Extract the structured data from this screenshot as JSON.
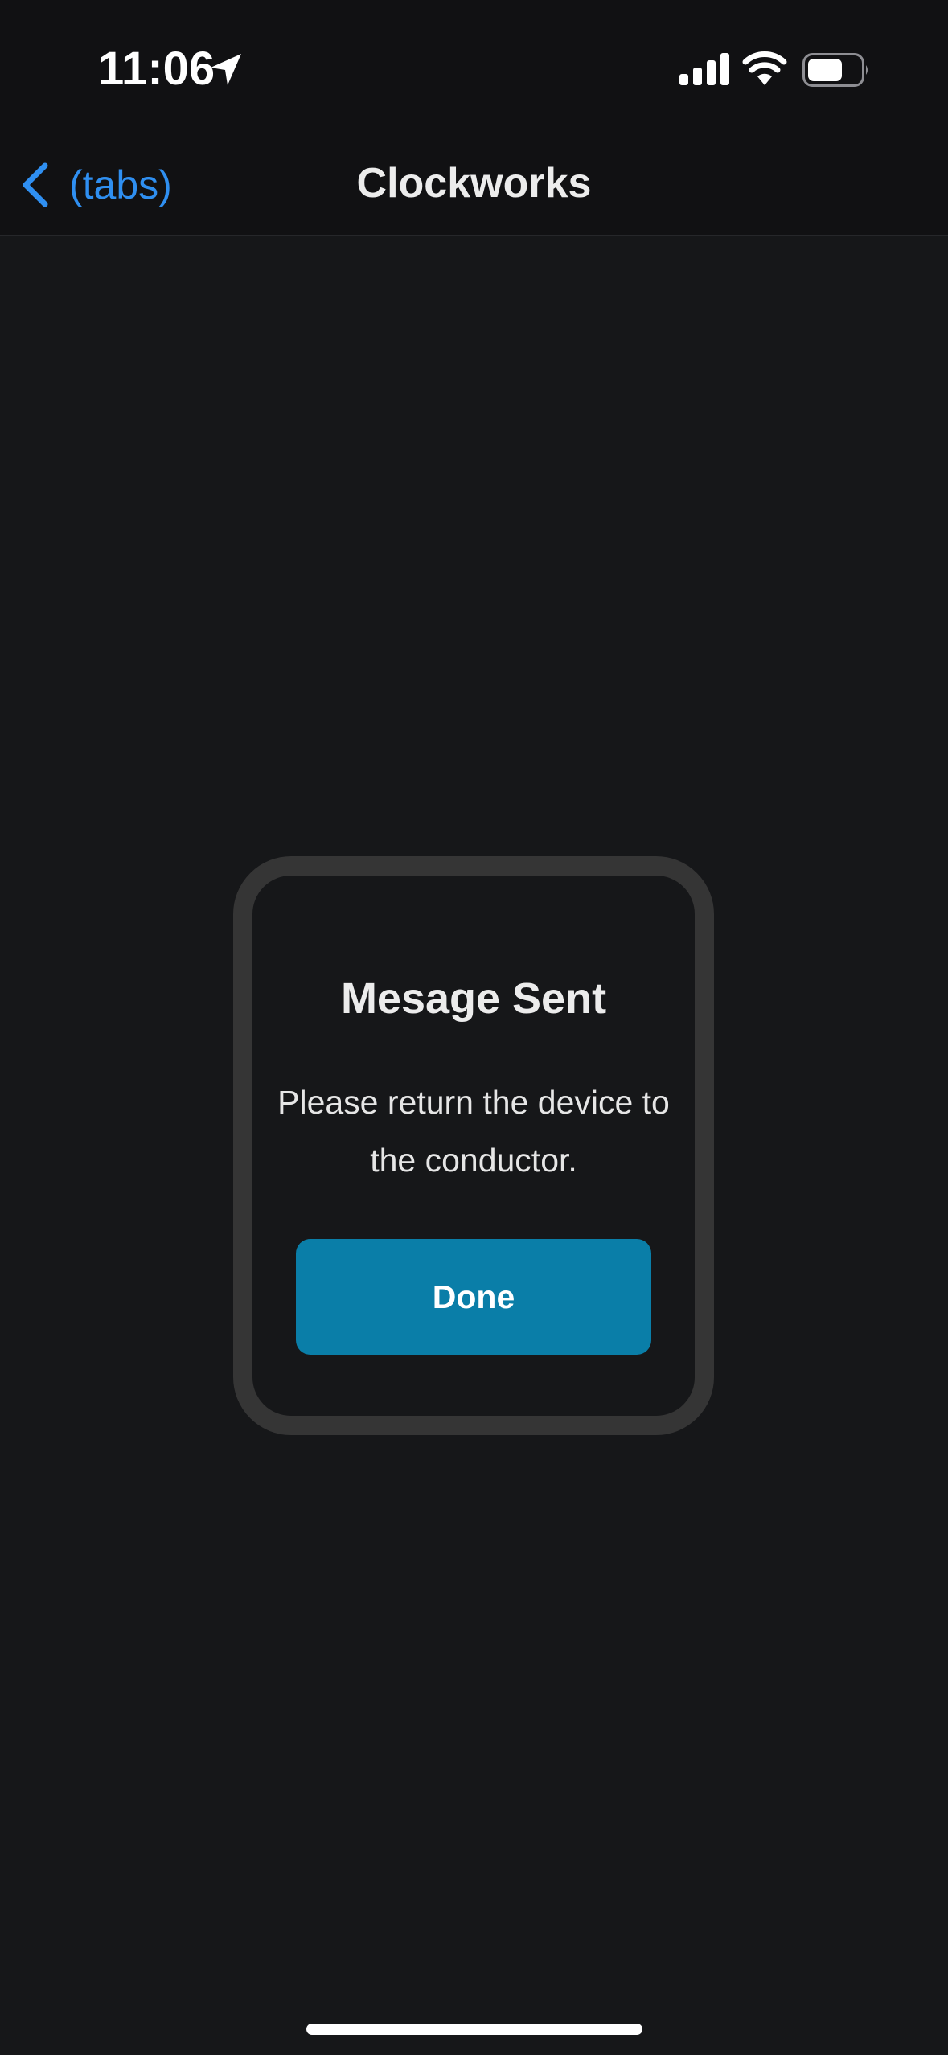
{
  "status_bar": {
    "time": "11:06",
    "icons": [
      "location-arrow-icon",
      "cellular-signal-icon",
      "wifi-icon",
      "battery-icon"
    ]
  },
  "nav": {
    "back_label": "(tabs)",
    "title": "Clockworks"
  },
  "dialog": {
    "title": "Mesage Sent",
    "message_line1": "Please return the device to",
    "message_line2": "the conductor.",
    "done_label": "Done"
  },
  "colors": {
    "background": "#161719",
    "bar_background": "#111113",
    "accent_link": "#2F8FF1",
    "button": "#0A7EA8",
    "card_border": "#353535"
  }
}
